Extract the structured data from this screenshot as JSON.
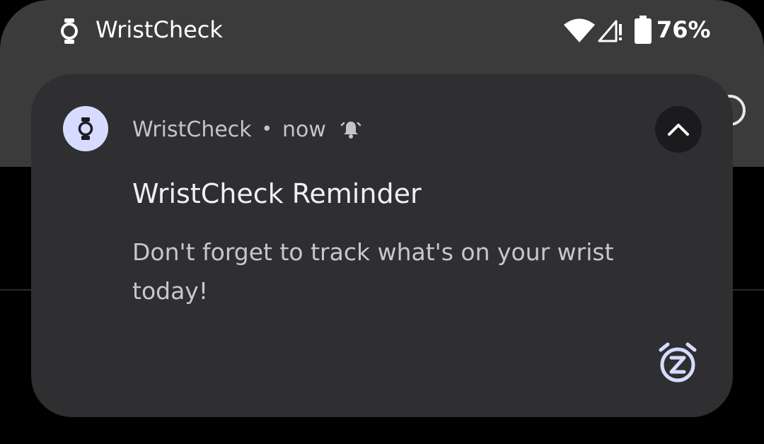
{
  "status_bar": {
    "app_name": "WristCheck",
    "battery_percent": "76%",
    "icons": [
      "watch-icon",
      "wifi-icon",
      "signal-icon",
      "battery-icon"
    ]
  },
  "notification": {
    "app_name": "WristCheck",
    "separator": "•",
    "time": "now",
    "title": "WristCheck Reminder",
    "body": "Don't forget to track what's on your wrist today!",
    "icons": [
      "watch-icon",
      "bell-icon",
      "chevron-up-icon",
      "snooze-icon"
    ]
  },
  "colors": {
    "card_background": "#2f2f31",
    "app_icon_background": "#d6dcff",
    "accent": "#d6dcff",
    "status_panel": "#3b3b3b"
  }
}
